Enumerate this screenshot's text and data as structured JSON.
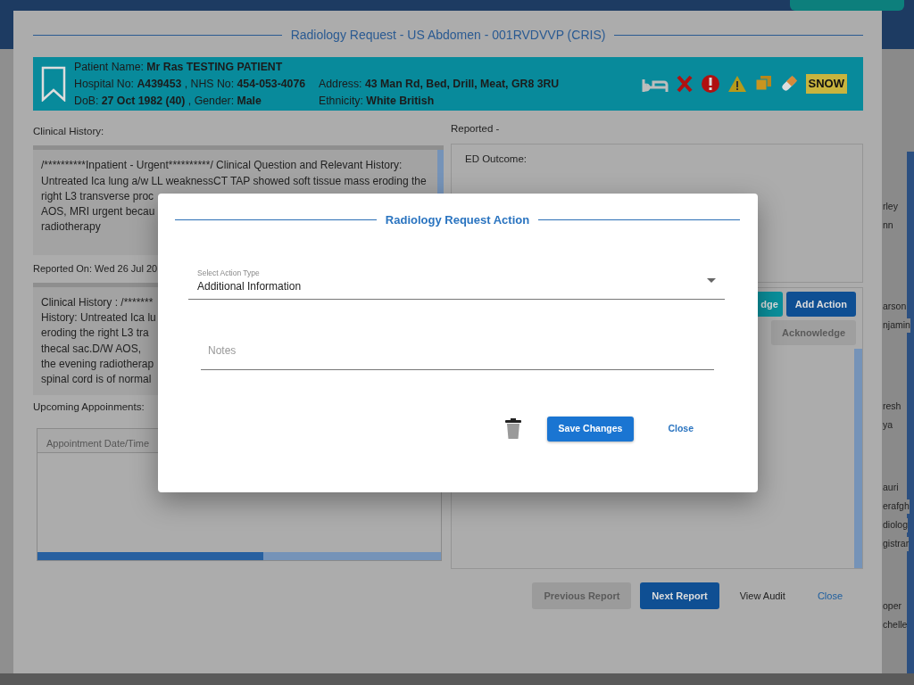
{
  "background": {
    "list_names": [
      "rley",
      "nn",
      "arson",
      "njamin",
      "resh",
      "ya",
      "auri",
      "erafgh",
      "diolog",
      "gistrar",
      "oper",
      "chelle"
    ]
  },
  "dialog": {
    "title": "Radiology Request - US Abdomen - 001RVDVVP (CRIS)",
    "patient": {
      "lines": [
        [
          "Patient Name: **Mr Ras TESTING PATIENT**"
        ],
        [
          "Hospital No: **A439453** , NHS No: **454-053-4076**",
          "Address: **43 Man Rd, Bed, Drill, Meat, GR8 3RU**"
        ],
        [
          "DoB: **27 Oct 1982 (40)** , Gender: **Male**",
          "Ethnicity: **White British**"
        ]
      ],
      "alerts": [
        {
          "kind": "bed"
        },
        {
          "kind": "cross"
        },
        {
          "kind": "exclamation"
        },
        {
          "kind": "warning"
        },
        {
          "kind": "copies"
        },
        {
          "kind": "pill"
        },
        {
          "kind": "tag",
          "text": "SNOW"
        }
      ]
    },
    "clinical_history": {
      "label": "Clinical History:",
      "lines": [
        "/**********Inpatient - Urgent**********/ Clinical Question and Relevant History:",
        "Untreated Ica lung a/w LL weaknessCT TAP showed soft tissue mass eroding the",
        "right L3 transverse proc",
        "AOS, MRI urgent becau",
        "radiotherapy"
      ]
    },
    "reported_on": {
      "label": "Reported On: Wed 26 Jul 20",
      "lines": [
        "Clinical History : /*******",
        "History: Untreated Ica lu",
        "eroding the right L3 tra",
        "thecal sac.D/W AOS,",
        "the evening radiotherap",
        "spinal cord is of normal"
      ]
    },
    "appointments": {
      "label": "Upcoming Appoinments:",
      "columns": [
        "Appointment Date/Time"
      ]
    },
    "report": {
      "label": "Reported -",
      "fields": [
        "ED Outcome:"
      ]
    },
    "action_buttons": [
      {
        "label": "dge",
        "kind": "teal",
        "disabled": false
      },
      {
        "label": "Add Action",
        "kind": "primary",
        "disabled": false
      },
      {
        "label": "Acknowledge",
        "kind": "plain",
        "disabled": true
      }
    ],
    "footer_buttons": [
      {
        "label": "Previous Report",
        "kind": "button",
        "disabled": true
      },
      {
        "label": "Next Report",
        "kind": "button",
        "disabled": false
      },
      {
        "label": "View Audit",
        "kind": "text"
      },
      {
        "label": "Close",
        "kind": "link"
      }
    ]
  },
  "modal": {
    "title": "Radiology Request Action",
    "select": {
      "label": "Select Action Type",
      "value": "Additional Information"
    },
    "notes": {
      "placeholder": "Notes"
    },
    "buttons": [
      {
        "kind": "delete"
      },
      {
        "kind": "primary",
        "label": "Save Changes"
      },
      {
        "kind": "link",
        "label": "Close"
      }
    ]
  }
}
